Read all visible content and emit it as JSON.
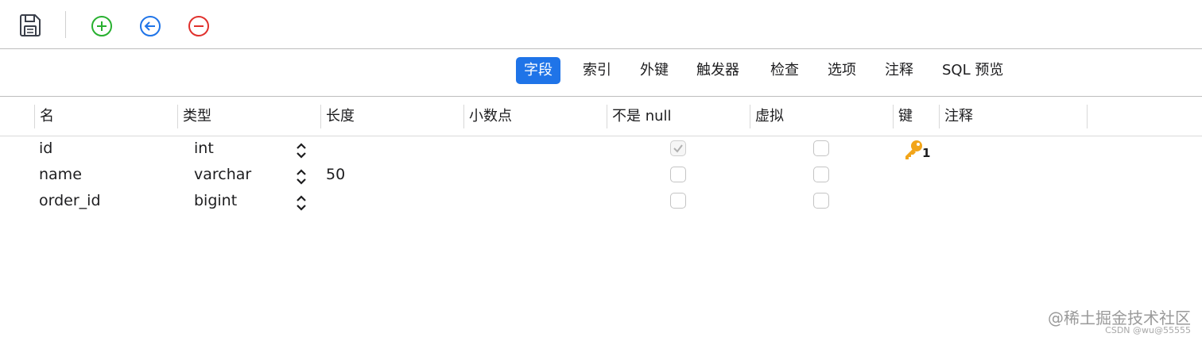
{
  "toolbar": {
    "buttons": [
      {
        "name": "save",
        "icon": "floppy-disk-icon",
        "color": "#3a3f4a"
      },
      {
        "name": "add-field",
        "icon": "plus-circle-icon",
        "color": "#28b030"
      },
      {
        "name": "insert-field",
        "icon": "arrow-left-circle-icon",
        "color": "#1f74e8"
      },
      {
        "name": "delete-field",
        "icon": "minus-circle-icon",
        "color": "#e0302c"
      }
    ]
  },
  "tabs": [
    {
      "label": "字段",
      "active": true
    },
    {
      "label": "索引",
      "active": false
    },
    {
      "label": "外键",
      "active": false
    },
    {
      "label": "触发器",
      "active": false
    },
    {
      "label": "检查",
      "active": false
    },
    {
      "label": "选项",
      "active": false
    },
    {
      "label": "注释",
      "active": false
    },
    {
      "label": "SQL 预览",
      "active": false
    }
  ],
  "columns": [
    "名",
    "类型",
    "长度",
    "小数点",
    "不是 null",
    "虚拟",
    "键",
    "注释"
  ],
  "rows": [
    {
      "name": "id",
      "type": "int",
      "length": "",
      "decimals": "",
      "not_null": true,
      "virtual": false,
      "key": "1",
      "comment": ""
    },
    {
      "name": "name",
      "type": "varchar",
      "length": "50",
      "decimals": "",
      "not_null": false,
      "virtual": false,
      "key": "",
      "comment": ""
    },
    {
      "name": "order_id",
      "type": "bigint",
      "length": "",
      "decimals": "",
      "not_null": false,
      "virtual": false,
      "key": "",
      "comment": ""
    }
  ],
  "watermark": {
    "main": "@稀土掘金技术社区",
    "sub": "CSDN @wu@55555"
  },
  "colors": {
    "accent": "#1f74e8",
    "key": "#f2a51a"
  }
}
